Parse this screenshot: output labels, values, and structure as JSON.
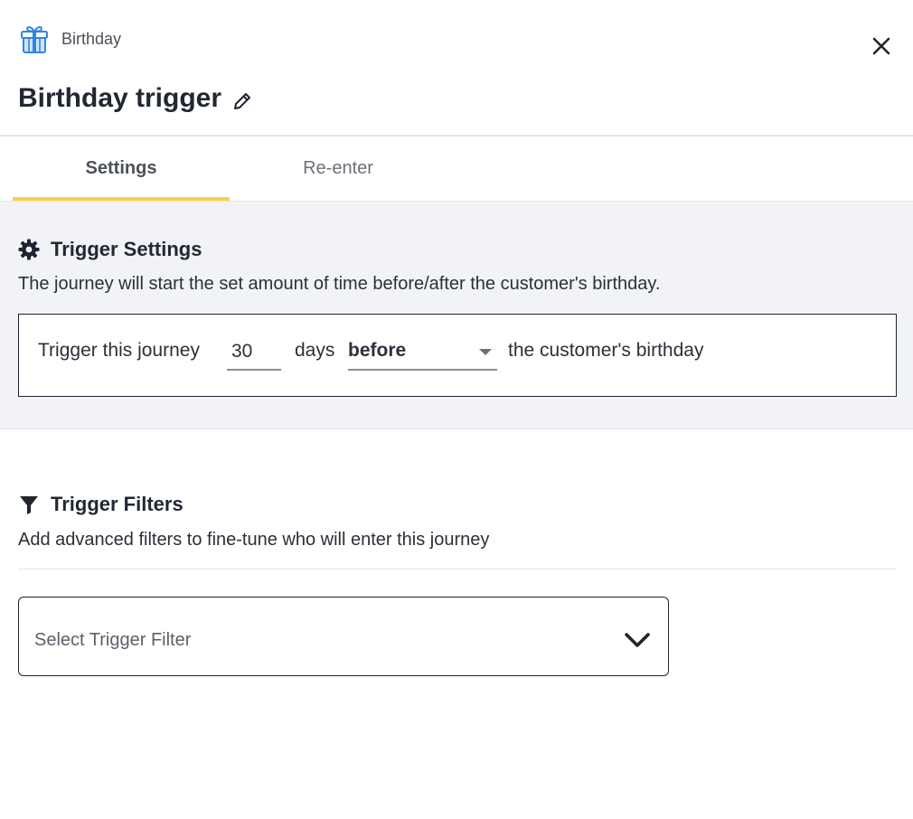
{
  "header": {
    "kind_label": "Birthday",
    "title": "Birthday trigger",
    "icons": {
      "kind": "gift-icon",
      "close": "close-icon",
      "edit": "pencil-icon"
    },
    "icon_color": "#2f86e0"
  },
  "tabs": [
    {
      "label": "Settings",
      "active": true
    },
    {
      "label": "Re-enter",
      "active": false
    }
  ],
  "accent_color": "#f5d24a",
  "trigger_settings": {
    "title": "Trigger Settings",
    "icon": "gear-icon",
    "description": "The journey will start the set amount of time before/after the customer's birthday.",
    "prefix": "Trigger this journey",
    "days_value": "30",
    "days_label": "days",
    "when_value": "before",
    "suffix": "the customer's birthday"
  },
  "trigger_filters": {
    "title": "Trigger Filters",
    "icon": "filter-icon",
    "description": "Add advanced filters to fine-tune who will enter this journey",
    "select_placeholder": "Select Trigger Filter"
  }
}
